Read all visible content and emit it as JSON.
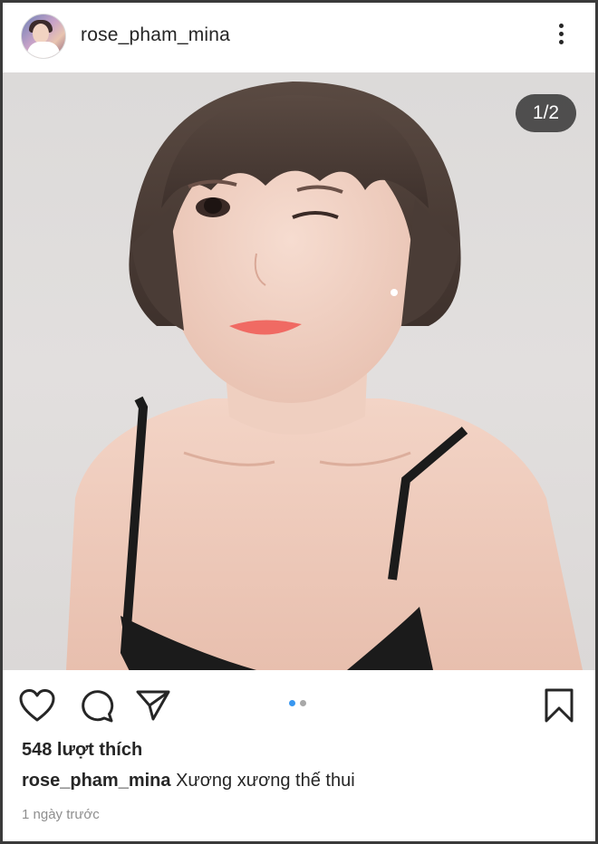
{
  "post": {
    "username": "rose_pham_mina",
    "image_counter": "1/2",
    "likes_text": "548 lượt thích",
    "caption_user": "rose_pham_mina",
    "caption_text": "Xương xương thế thui",
    "timestamp": "1 ngày trước",
    "carousel": {
      "total": 2,
      "active_index": 0
    }
  },
  "icons": {
    "more": "more-vertical-icon",
    "like": "heart-icon",
    "comment": "comment-bubble-icon",
    "share": "paper-plane-icon",
    "save": "bookmark-icon"
  },
  "colors": {
    "text_primary": "#262626",
    "text_secondary": "#8e8e8e",
    "carousel_active": "#3897f0",
    "carousel_inactive": "#a8a8a8",
    "counter_bg": "#262626"
  }
}
